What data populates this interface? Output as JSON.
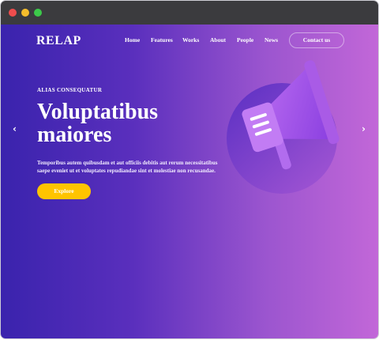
{
  "browser": {
    "controls": [
      "close",
      "minimize",
      "maximize"
    ]
  },
  "header": {
    "logo": "RELAP",
    "nav": [
      "Home",
      "Features",
      "Works",
      "About",
      "People",
      "News"
    ],
    "cta": "Contact us"
  },
  "hero": {
    "eyebrow": "ALIAS CONSEQUATUR",
    "title": "Voluptatibus maiores",
    "description": "Temporibus autem quibusdam et aut officiis debitis aut rerum necessitatibus saepe eveniet ut et voluptates repudiandae sint et molestiae non recusandae.",
    "button": "Explore"
  },
  "slider": {
    "prev_icon": "chevron-left-icon",
    "next_icon": "chevron-right-icon"
  },
  "illustration": {
    "icon": "megaphone-icon"
  },
  "colors": {
    "gradient_start": "#3a23ad",
    "gradient_end": "#c267d8",
    "button": "#ffc400",
    "megaphone": "#b15ee9"
  }
}
